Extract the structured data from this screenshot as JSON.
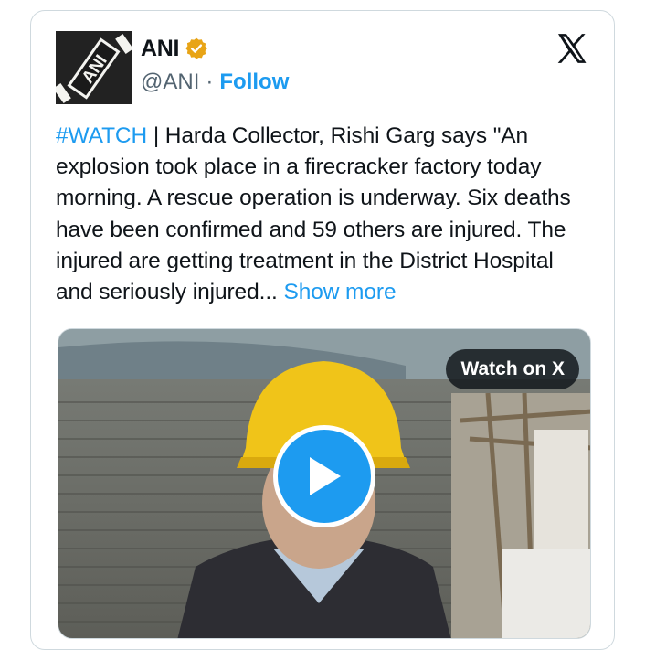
{
  "account": {
    "name": "ANI",
    "handle": "@ANI",
    "separator": "·",
    "follow_label": "Follow",
    "avatar_text": "ANI",
    "verified_icon": "verified-badge-icon",
    "verified_color": "#e8a416"
  },
  "platform_logo": "x-logo-icon",
  "tweet": {
    "hashtag": "#WATCH",
    "body": " | Harda Collector, Rishi Garg says \"An explosion took place in a firecracker factory today morning. A rescue operation is underway. Six deaths have been confirmed and 59 others are injured. The injured are getting treatment in the District Hospital and seriously injured... ",
    "show_more": "Show more"
  },
  "media": {
    "type": "video",
    "watch_label": "Watch on X",
    "play_icon": "play-icon"
  },
  "colors": {
    "accent": "#1d9bf0",
    "text": "#0f1419",
    "secondary": "#536471",
    "border": "#cfd9de"
  }
}
